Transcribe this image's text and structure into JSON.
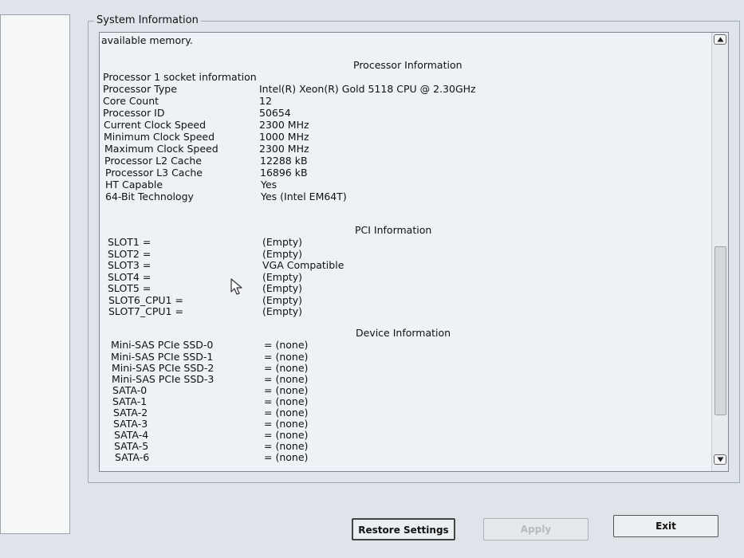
{
  "group_title": "System Information",
  "intro_text": "available memory.",
  "processor": {
    "section_title": "Processor Information",
    "socket_line": "Processor 1 socket information",
    "rows": [
      {
        "label": "Processor Type",
        "value": "Intel(R) Xeon(R) Gold 5118 CPU @ 2.30GHz"
      },
      {
        "label": "Core Count",
        "value": "12"
      },
      {
        "label": "Processor ID",
        "value": "50654"
      },
      {
        "label": "Current Clock Speed",
        "value": "2300 MHz"
      },
      {
        "label": "Minimum Clock Speed",
        "value": "1000 MHz"
      },
      {
        "label": "Maximum Clock Speed",
        "value": "2300 MHz"
      },
      {
        "label": "Processor L2 Cache",
        "value": "12288 kB"
      },
      {
        "label": "Processor L3 Cache",
        "value": "16896 kB"
      },
      {
        "label": "HT Capable",
        "value": "Yes"
      },
      {
        "label": "64-Bit Technology",
        "value": "Yes (Intel EM64T)"
      }
    ]
  },
  "pci": {
    "section_title": "PCI Information",
    "rows": [
      {
        "label": "SLOT1 =",
        "value": "(Empty)"
      },
      {
        "label": "SLOT2 =",
        "value": "(Empty)"
      },
      {
        "label": "SLOT3 =",
        "value": "VGA Compatible"
      },
      {
        "label": "SLOT4 =",
        "value": "(Empty)"
      },
      {
        "label": "SLOT5 =",
        "value": "(Empty)"
      },
      {
        "label": "SLOT6_CPU1 =",
        "value": "(Empty)"
      },
      {
        "label": "SLOT7_CPU1 =",
        "value": "(Empty)"
      }
    ]
  },
  "device": {
    "section_title": "Device Information",
    "rows": [
      {
        "label": "Mini-SAS PCIe SSD-0",
        "value": "= (none)"
      },
      {
        "label": "Mini-SAS PCIe SSD-1",
        "value": "= (none)"
      },
      {
        "label": "Mini-SAS PCIe SSD-2",
        "value": "= (none)"
      },
      {
        "label": "Mini-SAS PCIe SSD-3",
        "value": "= (none)"
      },
      {
        "label": "SATA-0",
        "value": "= (none)"
      },
      {
        "label": "SATA-1",
        "value": "= (none)"
      },
      {
        "label": "SATA-2",
        "value": "= (none)"
      },
      {
        "label": "SATA-3",
        "value": "= (none)"
      },
      {
        "label": "SATA-4",
        "value": "= (none)"
      },
      {
        "label": "SATA-5",
        "value": "= (none)"
      },
      {
        "label": "SATA-6",
        "value": "= (none)"
      }
    ]
  },
  "buttons": {
    "restore_label": "Restore Settings",
    "apply_label": "Apply",
    "exit_label": "Exit"
  },
  "icons": {
    "scroll_up": "triangle-up-icon",
    "scroll_down": "triangle-down-icon",
    "cursor": "mouse-pointer-icon"
  }
}
